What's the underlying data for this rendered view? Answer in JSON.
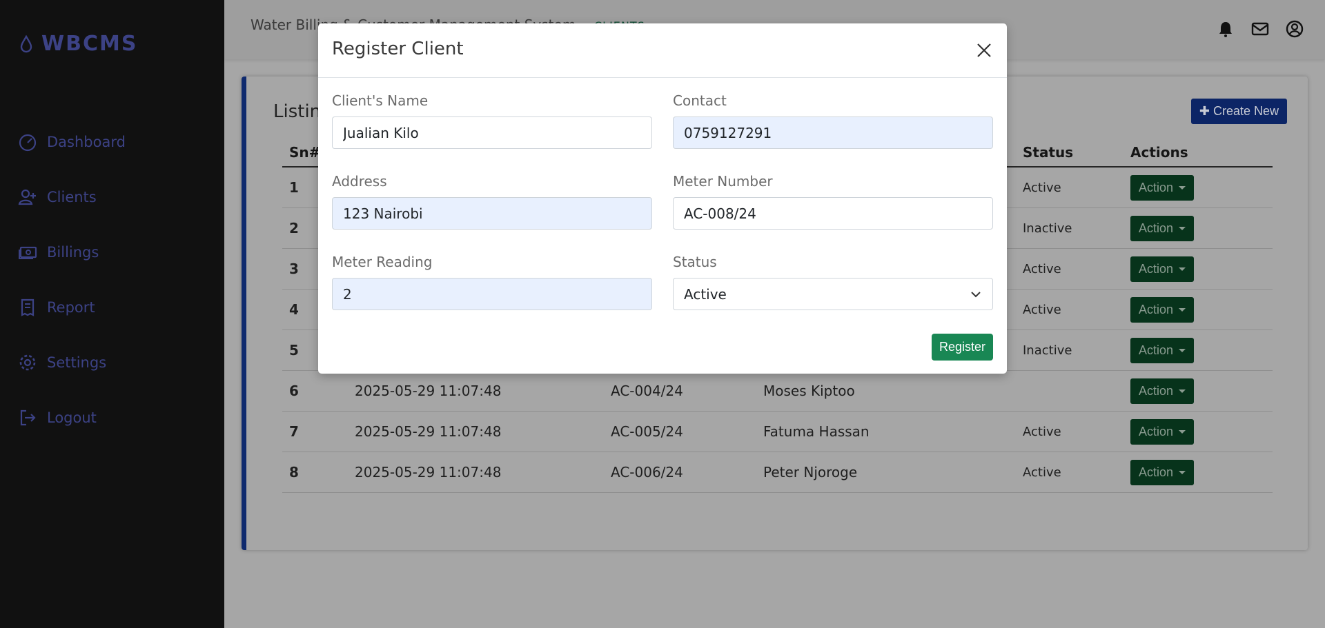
{
  "brand": {
    "name": "WBCMS",
    "icon": "water-drop-icon"
  },
  "sidebar": {
    "items": [
      {
        "label": "Dashboard",
        "icon": "gauge-icon"
      },
      {
        "label": "Clients",
        "icon": "user-plus-icon"
      },
      {
        "label": "Billings",
        "icon": "money-bill-icon"
      },
      {
        "label": "Report",
        "icon": "receipt-icon"
      },
      {
        "label": "Settings",
        "icon": "gear-icon"
      },
      {
        "label": "Logout",
        "icon": "logout-icon"
      }
    ]
  },
  "topbar": {
    "title": "Water Billing & Customer Management System",
    "crumb": "CLIENTS",
    "icons": [
      "bell-icon",
      "envelope-icon",
      "user-circle-icon"
    ]
  },
  "card": {
    "title": "Listing",
    "create_label": "Create New"
  },
  "table": {
    "headers": [
      "Sn#",
      "",
      "",
      "",
      "Status",
      "Actions"
    ],
    "rows": [
      {
        "sn": "1",
        "date": "",
        "meter": "",
        "name": "",
        "status": "Active",
        "action": "Action"
      },
      {
        "sn": "2",
        "date": "",
        "meter": "",
        "name": "",
        "status": "Inactive",
        "action": "Action"
      },
      {
        "sn": "3",
        "date": "",
        "meter": "",
        "name": "",
        "status": "Active",
        "action": "Action"
      },
      {
        "sn": "4",
        "date": "",
        "meter": "",
        "name": "",
        "status": "Active",
        "action": "Action"
      },
      {
        "sn": "5",
        "date": "",
        "meter": "",
        "name": "",
        "status": "Inactive",
        "action": "Action"
      },
      {
        "sn": "6",
        "date": "2025-05-29 11:07:48",
        "meter": "AC-004/24",
        "name": "Moses Kiptoo",
        "status": "",
        "action": "Action"
      },
      {
        "sn": "7",
        "date": "2025-05-29 11:07:48",
        "meter": "AC-005/24",
        "name": "Fatuma Hassan",
        "status": "Active",
        "action": "Action"
      },
      {
        "sn": "8",
        "date": "2025-05-29 11:07:48",
        "meter": "AC-006/24",
        "name": "Peter Njoroge",
        "status": "Active",
        "action": "Action"
      }
    ]
  },
  "modal": {
    "title": "Register Client",
    "fields": {
      "name": {
        "label": "Client's Name",
        "value": "Jualian Kilo"
      },
      "contact": {
        "label": "Contact",
        "value": "0759127291"
      },
      "address": {
        "label": "Address",
        "value": "123 Nairobi"
      },
      "meter_number": {
        "label": "Meter Number",
        "value": "AC-008/24"
      },
      "meter_reading": {
        "label": "Meter Reading",
        "value": "2"
      },
      "status": {
        "label": "Status",
        "value": "Active"
      }
    },
    "register_label": "Register"
  },
  "colors": {
    "register": "#198754",
    "autofill": "#e8f0fe",
    "accent": "#0d6efd"
  }
}
